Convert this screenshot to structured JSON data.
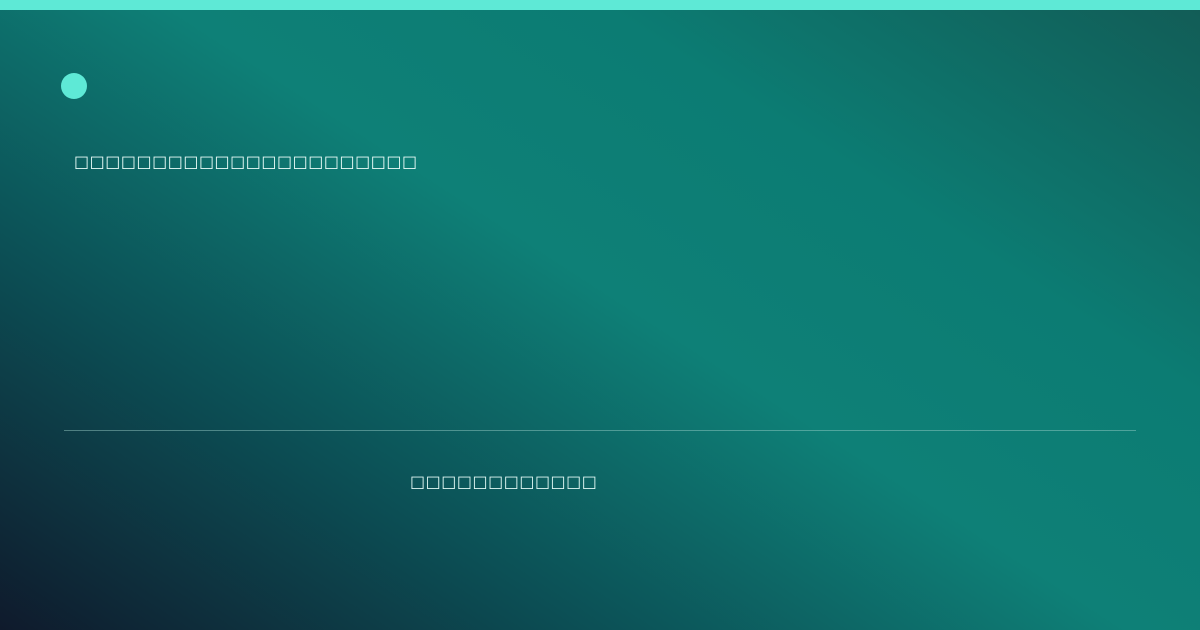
{
  "colors": {
    "accent": "#5ee9d6",
    "text": "#e8fbf7"
  },
  "icons": {
    "brand_mark": "accent-dot-icon"
  },
  "headline": {
    "text": "□□□□□□□□□□□□□□□□□□□□□□"
  },
  "footer": {
    "label": "□□□□□□□□□□□□"
  }
}
